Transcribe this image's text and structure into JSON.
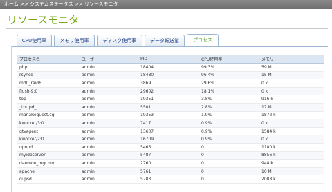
{
  "breadcrumb": "ホーム >> システムステータス >> リソースモニタ",
  "page_title": "リソースモニタ",
  "tabs": [
    "CPU使用率",
    "メモリ使用率",
    "ディスク使用率",
    "データ転送量",
    "プロセス"
  ],
  "active_tab": 4,
  "table": {
    "headers": [
      "プロセス名",
      "ユーザ",
      "PID",
      "CPU使用率",
      "メモリ"
    ],
    "rows": [
      [
        "php",
        "admin",
        "18404",
        "99.3%",
        "59 M"
      ],
      [
        "rsyncd",
        "admin",
        "18480",
        "96.4%",
        "15 M"
      ],
      [
        "md0_raid6",
        "admin",
        "3869",
        "29.6%",
        "0 k"
      ],
      [
        "flush-9:0",
        "admin",
        "29602",
        "18.1%",
        "0 k"
      ],
      [
        "top",
        "admin",
        "19351",
        "3.8%",
        "916 k"
      ],
      [
        "_thttpd_",
        "admin",
        "5501",
        "2.8%",
        "17 M"
      ],
      [
        "manaRequest.cgi",
        "admin",
        "19353",
        "1.9%",
        "1872 k"
      ],
      [
        "kworker/3:0",
        "admin",
        "7417",
        "0.9%",
        "0 k"
      ],
      [
        "qtvagent",
        "admin",
        "13607",
        "0.9%",
        "1584 k"
      ],
      [
        "kworker/2:0",
        "admin",
        "16709",
        "0.9%",
        "0 k"
      ],
      [
        "upnpd",
        "admin",
        "5465",
        "0",
        "1180 k"
      ],
      [
        "myidbserver",
        "admin",
        "5487",
        "0",
        "8856 k"
      ],
      [
        "daemon_mgr.nvr",
        "admin",
        "2760",
        "0",
        "948 k"
      ],
      [
        "apache",
        "admin",
        "5761",
        "0",
        "10 M"
      ],
      [
        "cupsd",
        "admin",
        "5783",
        "0",
        "2088 k"
      ]
    ]
  }
}
